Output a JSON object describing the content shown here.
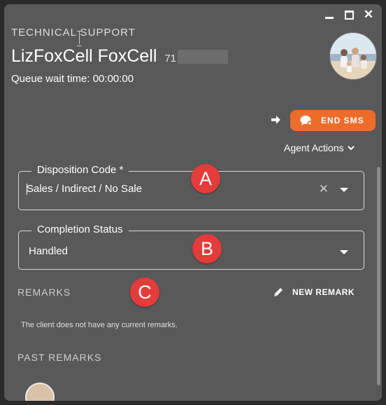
{
  "header": {
    "section_label": "TECHNICAL SUPPORT",
    "contact_name": "LizFoxCell FoxCell",
    "contact_number_prefix": "71",
    "queue_wait": "Queue wait time: 00:00:00"
  },
  "actions": {
    "end_sms_label": "END SMS",
    "end_sms_color": "#ee6c2a",
    "agent_actions_label": "Agent Actions"
  },
  "disposition": {
    "legend": "Disposition Code *",
    "value": "Sales / Indirect / No Sale"
  },
  "completion": {
    "legend": "Completion Status",
    "value": "Handled"
  },
  "annotations": {
    "a": "A",
    "b": "B",
    "c": "C",
    "badge_color": "#e43b3b"
  },
  "remarks": {
    "heading": "REMARKS",
    "new_remark_label": "NEW REMARK",
    "empty_message": "The client does not have any current remarks."
  },
  "past_remarks": {
    "heading": "PAST REMARKS"
  },
  "icons": [
    "minimize-icon",
    "maximize-icon",
    "close-icon",
    "arrow-right-icon",
    "chat-end-icon",
    "chevron-down-icon",
    "clear-icon",
    "dropdown-arrow-icon",
    "pencil-icon"
  ]
}
